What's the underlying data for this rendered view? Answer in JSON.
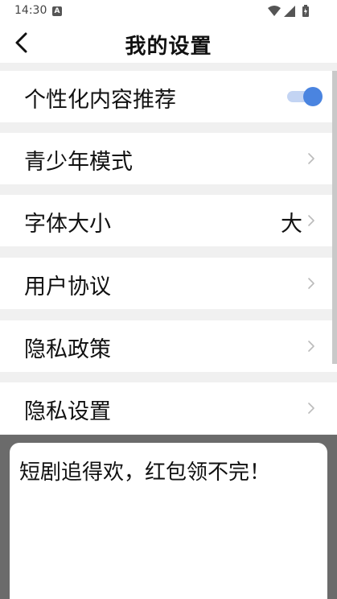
{
  "status_bar": {
    "time": "14:30",
    "notification_badge": "A",
    "icons": [
      "wifi-icon",
      "signal-icon",
      "battery-icon"
    ]
  },
  "header": {
    "title": "我的设置",
    "back_icon": "back-arrow-icon"
  },
  "settings": [
    {
      "label": "个性化内容推荐",
      "control": "toggle",
      "toggle_on": true
    },
    {
      "label": "青少年模式",
      "control": "chevron"
    },
    {
      "label": "字体大小",
      "value": "大",
      "control": "chevron"
    },
    {
      "label": "用户协议",
      "control": "chevron"
    },
    {
      "label": "隐私政策",
      "control": "chevron"
    },
    {
      "label": "隐私设置",
      "control": "chevron"
    }
  ],
  "promo": {
    "text": "短剧追得欢，红包领不完！"
  },
  "colors": {
    "accent": "#4a84e0",
    "toggle_track": "#c3d4f3",
    "page_background": "#f0f0f0",
    "overlay": "#6b6b6b"
  }
}
